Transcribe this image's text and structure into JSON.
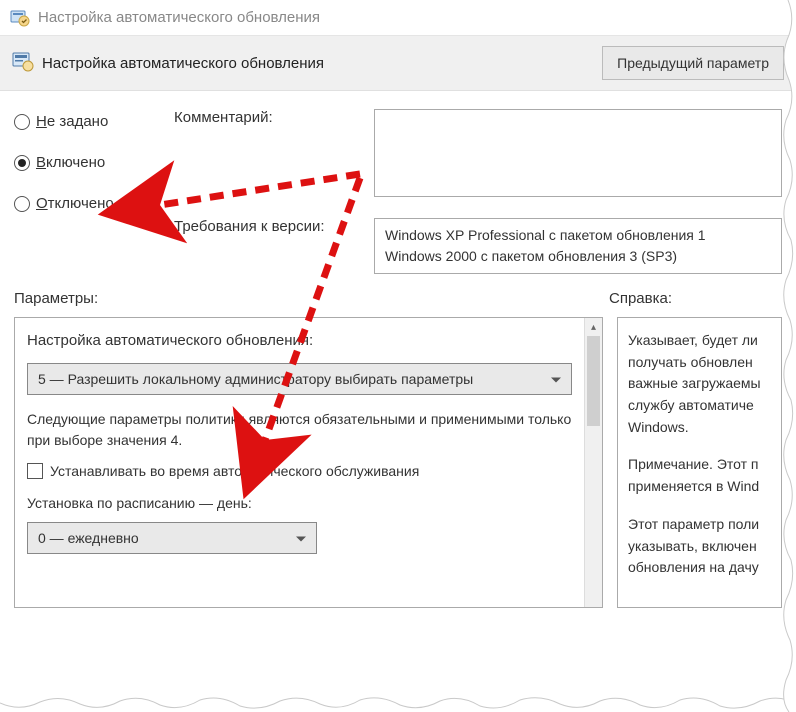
{
  "titlebar": {
    "text": "Настройка автоматического обновления"
  },
  "header": {
    "title": "Настройка автоматического обновления",
    "prev_button": "Предыдущий параметр"
  },
  "radios": {
    "not_configured": "е задано",
    "not_configured_m": "Н",
    "enabled": "ключено",
    "enabled_m": "В",
    "disabled": "тключено",
    "disabled_m": "О"
  },
  "comment_label": "Комментарий:",
  "requirements_label": "Требования к версии:",
  "requirements": {
    "line1": "Windows XP Professional с пакетом обновления 1",
    "line2": "Windows 2000 с пакетом обновления 3 (SP3)"
  },
  "sections": {
    "params": "Параметры:",
    "help": "Справка:"
  },
  "params": {
    "heading": "Настройка автоматического обновления:",
    "mode_value": "5 — Разрешить локальному администратору выбирать параметры",
    "paragraph": "Следующие параметры политики являются обязательными и применимыми только при выборе значения 4.",
    "checkbox_label": "Устанавливать во время автоматического обслуживания",
    "schedule_label": "Установка по расписанию — день:",
    "schedule_value": "0 — ежедневно"
  },
  "help": {
    "p1": "Указывает, будет ли получать обновлен важные загружаемы службу автоматиче Windows.",
    "p2": "Примечание. Этот п применяется в Wind",
    "p3": "Этот параметр поли указывать, включен обновления на дачу"
  }
}
